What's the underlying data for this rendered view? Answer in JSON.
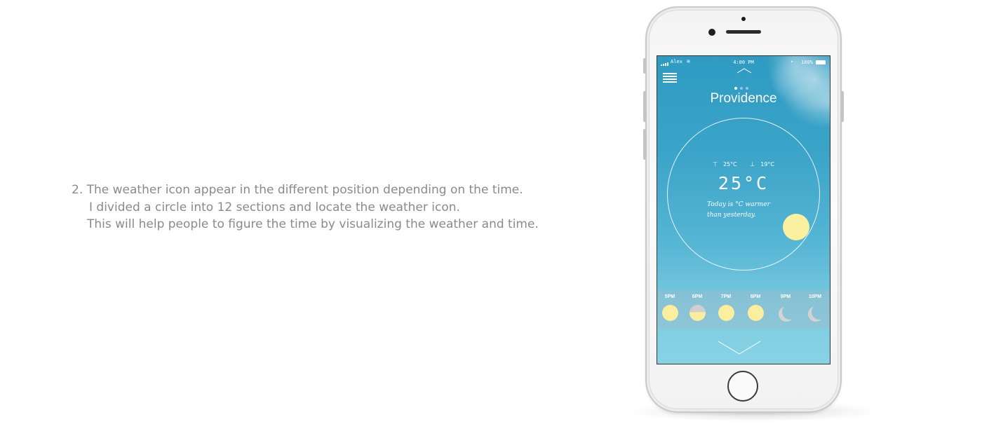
{
  "description": {
    "line1": "2. The weather icon appear in the different position depending on the time.",
    "line2": "I divided a circle into 12 sections and locate the weather icon.",
    "line3": "This will help people to figure the time by visualizing the weather and time."
  },
  "status_bar": {
    "carrier": "Alex",
    "wifi_icon": "wifi-icon",
    "time": "4:00 PM",
    "battery": "100%"
  },
  "weather": {
    "city": "Providence",
    "high": "25°C",
    "low": "19°C",
    "temperature": "25°C",
    "note_line1": "Today is  °C warmer",
    "note_line2": "than yesterday.",
    "page_dots": 3,
    "active_page": 0
  },
  "hourly": [
    {
      "time": "5PM",
      "icon": "sun"
    },
    {
      "time": "6PM",
      "icon": "sun-half"
    },
    {
      "time": "7PM",
      "icon": "sun"
    },
    {
      "time": "8PM",
      "icon": "sun"
    },
    {
      "time": "9PM",
      "icon": "moon"
    },
    {
      "time": "10PM",
      "icon": "moon"
    }
  ],
  "colors": {
    "sky_top": "#2f9bc2",
    "sky_bottom": "#86d3e4",
    "sun": "#fbee9d",
    "moon": "#d3d3d3",
    "text_gray": "#8a8a8a"
  }
}
